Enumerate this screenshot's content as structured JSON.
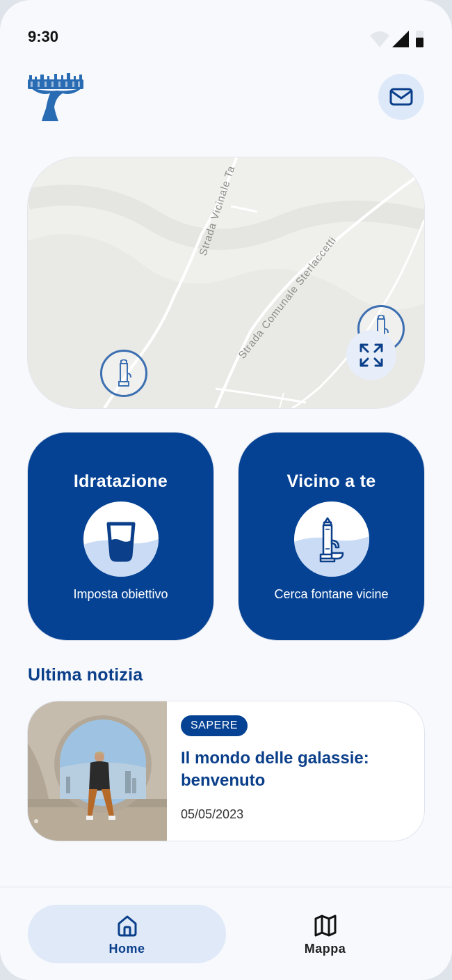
{
  "status_bar": {
    "time": "9:30"
  },
  "header": {
    "logo_icon": "tree-logo-icon",
    "mail_icon": "mail-icon"
  },
  "map": {
    "road_labels": [
      "Strada Vicinale Ta",
      "Strada Comunale Sterlaccetti"
    ],
    "expand_icon": "expand-icon",
    "pin_icon": "fountain-icon"
  },
  "actions": [
    {
      "title": "Idratazione",
      "subtitle": "Imposta obiettivo",
      "icon": "water-glass-icon"
    },
    {
      "title": "Vicino a te",
      "subtitle": "Cerca fontane vicine",
      "icon": "fountain-icon"
    }
  ],
  "news_section": {
    "title": "Ultima notizia",
    "card": {
      "tag": "SAPERE",
      "title": "Il mondo delle galassie: benvenuto",
      "date": "05/05/2023"
    }
  },
  "bottom_nav": {
    "items": [
      {
        "label": "Home",
        "icon": "home-icon",
        "active": true
      },
      {
        "label": "Mappa",
        "icon": "map-icon",
        "active": false
      }
    ]
  },
  "colors": {
    "primary": "#054294",
    "accent_light": "#dfe9f8",
    "pin": "#3c6fb1",
    "background": "#f7f9fd"
  }
}
